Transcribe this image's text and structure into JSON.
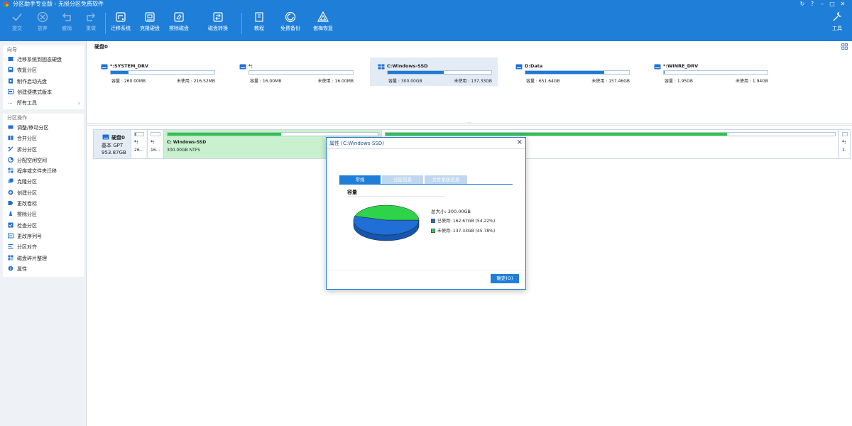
{
  "app": {
    "title": "分区助手专业版 - 无损分区免费软件"
  },
  "toolbar": {
    "items": [
      {
        "id": "commit",
        "label": "提交",
        "icon": "check-icon",
        "enabled": false
      },
      {
        "id": "discard",
        "label": "放弃",
        "icon": "cancel-icon",
        "enabled": false
      },
      {
        "id": "undo",
        "label": "撤销",
        "icon": "undo-icon",
        "enabled": false
      },
      {
        "id": "redo",
        "label": "重做",
        "icon": "redo-icon",
        "enabled": false
      },
      {
        "id": "migrate",
        "label": "迁移系统",
        "icon": "migrate-icon",
        "enabled": true
      },
      {
        "id": "clone",
        "label": "克隆硬盘",
        "icon": "clone-icon",
        "enabled": true
      },
      {
        "id": "wipe",
        "label": "擦除磁盘",
        "icon": "wipe-icon",
        "enabled": true
      },
      {
        "id": "convert",
        "label": "磁盘转换",
        "icon": "convert-icon",
        "enabled": true
      },
      {
        "id": "tutorial",
        "label": "教程",
        "icon": "book-icon",
        "enabled": true
      },
      {
        "id": "backup",
        "label": "免费备份",
        "icon": "backup-icon",
        "enabled": true
      },
      {
        "id": "restore",
        "label": "傲梅恢复",
        "icon": "restore-icon",
        "enabled": true
      }
    ],
    "tools_label": "工具"
  },
  "sidebar": {
    "wizard_title": "向导",
    "wizard_items": [
      {
        "label": "迁移系统到固态硬盘",
        "icon": "ssd-icon"
      },
      {
        "label": "恢复分区",
        "icon": "recover-icon"
      },
      {
        "label": "制作启动光盘",
        "icon": "disc-icon"
      },
      {
        "label": "创建便携式版本",
        "icon": "portable-icon"
      },
      {
        "label": "所有工具",
        "icon": "more-icon",
        "arrow": "›"
      }
    ],
    "ops_title": "分区操作",
    "ops_items": [
      {
        "label": "调整/移动分区",
        "icon": "resize-icon"
      },
      {
        "label": "合并分区",
        "icon": "merge-icon"
      },
      {
        "label": "拆分分区",
        "icon": "split-icon"
      },
      {
        "label": "分配空闲空间",
        "icon": "allocate-icon"
      },
      {
        "label": "程序或文件夹迁移",
        "icon": "app-move-icon"
      },
      {
        "label": "克隆分区",
        "icon": "clone-icon"
      },
      {
        "label": "创建分区",
        "icon": "create-icon"
      },
      {
        "label": "更改卷标",
        "icon": "label-icon"
      },
      {
        "label": "擦除分区",
        "icon": "wipe-icon"
      },
      {
        "label": "检查分区",
        "icon": "check-icon"
      },
      {
        "label": "更改序列号",
        "icon": "serial-icon"
      },
      {
        "label": "分区对齐",
        "icon": "align-icon"
      },
      {
        "label": "磁盘碎片整理",
        "icon": "defrag-icon"
      },
      {
        "label": "属性",
        "icon": "info-icon"
      }
    ]
  },
  "main": {
    "disk_title": "硬盘0",
    "cap_prefix": "容量 : ",
    "free_prefix": "未使用 : ",
    "partitions": [
      {
        "name": "*:SYSTEM_DRV",
        "capacity": "260.00MB",
        "free": "216.52MB",
        "used_fraction": 0.17,
        "selected": false,
        "icon": "drive-icon"
      },
      {
        "name": "*:",
        "capacity": "16.00MB",
        "free": "16.00MB",
        "used_fraction": 0.0,
        "selected": false,
        "icon": "drive-icon"
      },
      {
        "name": "C:Windows-SSD",
        "capacity": "300.00GB",
        "free": "137.33GB",
        "used_fraction": 0.54,
        "selected": true,
        "icon": "windows-icon"
      },
      {
        "name": "D:Data",
        "capacity": "651.64GB",
        "free": "157.46GB",
        "used_fraction": 0.76,
        "selected": false,
        "icon": "drive-icon"
      },
      {
        "name": "*:WINRE_DRV",
        "capacity": "1.95GB",
        "free": "1.94GB",
        "used_fraction": 0.01,
        "selected": false,
        "icon": "drive-icon"
      }
    ],
    "disk_map": {
      "name": "硬盘0",
      "type": "基本 GPT",
      "size": "953.87GB",
      "parts": [
        {
          "label": "*:",
          "sub": "26...",
          "used_fraction": 0.17,
          "selected": false
        },
        {
          "label": "*:",
          "sub": "16...",
          "used_fraction": 0.0,
          "selected": false
        },
        {
          "label": "C: Windows-SSD",
          "sub": "300.00GB NTFS",
          "used_fraction": 0.54,
          "selected": true
        },
        {
          "label": "",
          "sub": "",
          "used_fraction": 0.76,
          "selected": false
        },
        {
          "label": "*:",
          "sub": "1.",
          "used_fraction": 0.01,
          "selected": false
        }
      ]
    }
  },
  "dialog": {
    "title": "属性 (C:Windows-SSD)",
    "tabs": [
      "常规",
      "分区信息",
      "文件系统信息"
    ],
    "capacity_title": "容量",
    "total": "总大小: 300.00GB",
    "used": "已使用: 162.67GB (54.22%)",
    "free": "未使用: 137.33GB (45.78%)",
    "used_fraction": 0.5422,
    "ok_label": "确定(O)",
    "colors": {
      "used": "#1f6fd6",
      "free": "#2ed34a"
    }
  },
  "colors": {
    "accent": "#1f7fd8",
    "bar_used": "#1e7ad4",
    "map_used": "#2fc54b"
  }
}
